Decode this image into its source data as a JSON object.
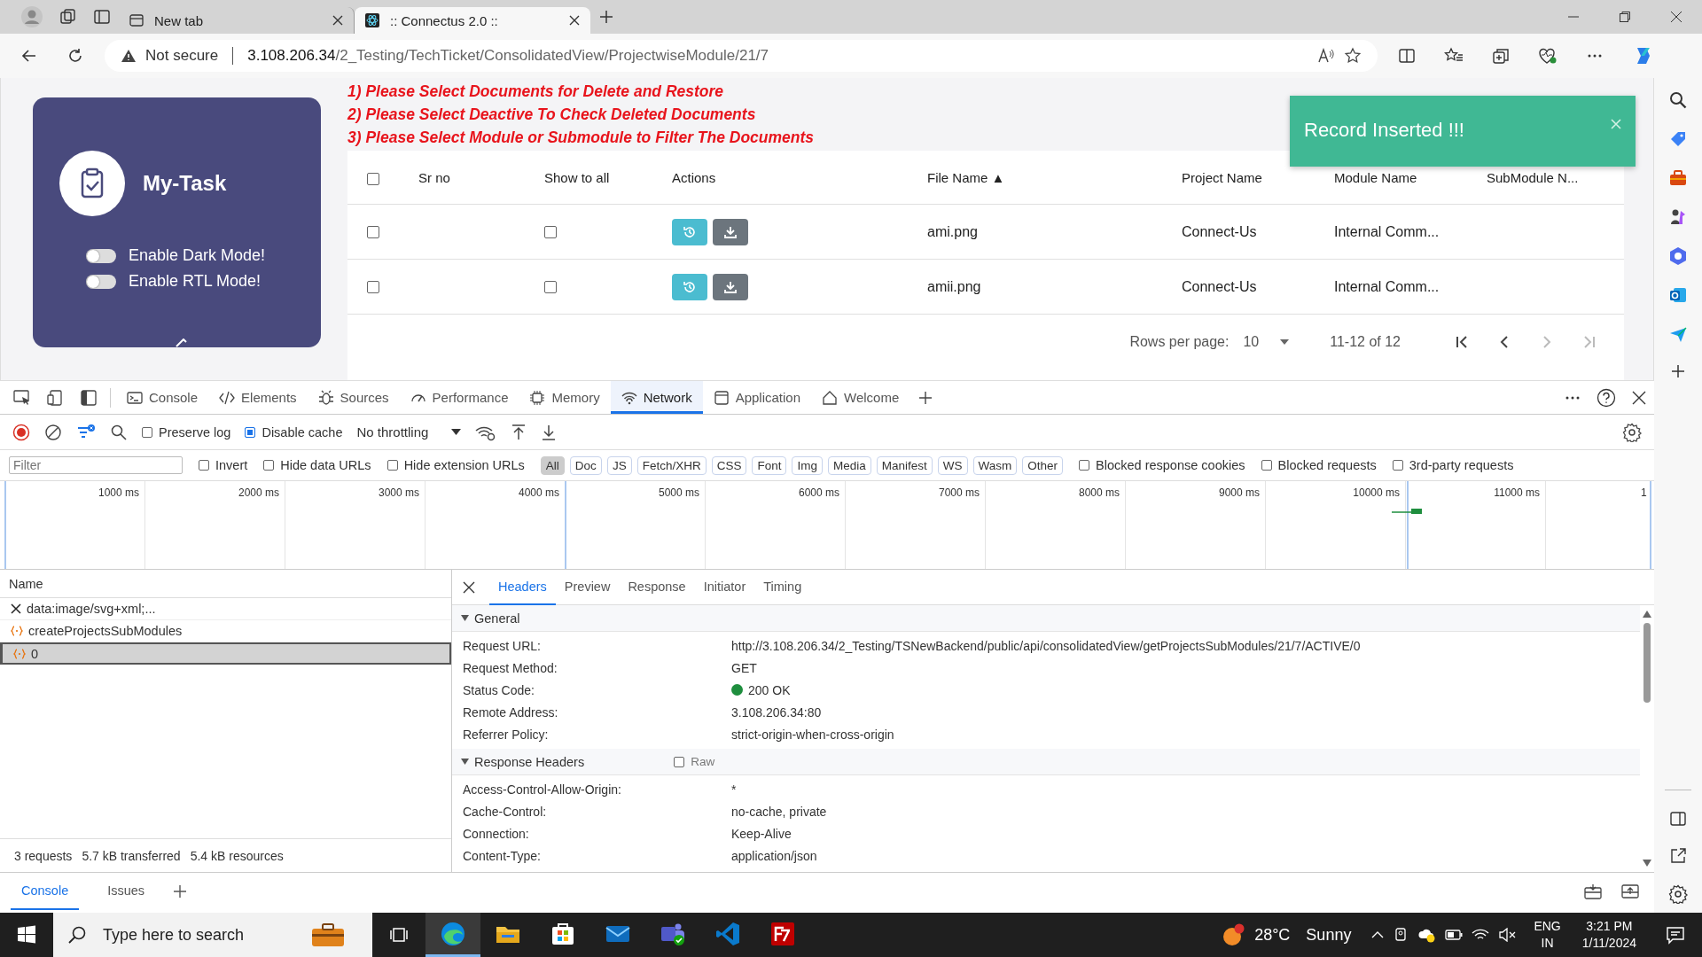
{
  "browser": {
    "tabs": [
      {
        "title": "New tab",
        "selected": false
      },
      {
        "title": ":: Connectus 2.0 ::",
        "selected": true
      }
    ],
    "address": {
      "security": "Not secure",
      "host": "3.108.206.34",
      "path": "/2_Testing/TechTicket/ConsolidatedView/ProjectwiseModule/21/7"
    }
  },
  "page": {
    "card": {
      "title": "My-Task",
      "toggles": [
        {
          "label": "Enable Dark Mode!",
          "on": false
        },
        {
          "label": "Enable RTL Mode!",
          "on": false
        }
      ]
    },
    "instructions": [
      "1) Please Select Documents for Delete and Restore",
      "2) Please Select Deactive To Check Deleted Documents",
      "3) Please Select Module or Submodule to Filter The Documents"
    ],
    "table": {
      "select_all": false,
      "columns": [
        "Sr no",
        "Show to all",
        "Actions",
        "File Name ▲",
        "Project Name",
        "Module Name",
        "SubModule N..."
      ],
      "rows": [
        {
          "checked": false,
          "sr_no": "",
          "show_to_all": false,
          "file_name": "ami.png",
          "project": "Connect-Us",
          "module": "Internal Comm..."
        },
        {
          "checked": false,
          "sr_no": "",
          "show_to_all": false,
          "file_name": "amii.png",
          "project": "Connect-Us",
          "module": "Internal Comm..."
        }
      ]
    },
    "pagination": {
      "label": "Rows per page:",
      "rows_per_page": "10",
      "range": "11-12 of 12"
    },
    "toast": {
      "message": "Record Inserted !!!"
    }
  },
  "devtools": {
    "tabs": [
      {
        "label": "Console",
        "selected": false
      },
      {
        "label": "Elements",
        "selected": false
      },
      {
        "label": "Sources",
        "selected": false
      },
      {
        "label": "Performance",
        "selected": false
      },
      {
        "label": "Memory",
        "selected": false
      },
      {
        "label": "Network",
        "selected": true
      },
      {
        "label": "Application",
        "selected": false
      },
      {
        "label": "Welcome",
        "selected": false
      }
    ],
    "toolbar": {
      "preserve_log": false,
      "preserve_log_label": "Preserve log",
      "disable_cache": true,
      "disable_cache_label": "Disable cache",
      "throttling": "No throttling"
    },
    "filter": {
      "placeholder": "Filter",
      "options": [
        {
          "label": "Invert",
          "checked": false
        },
        {
          "label": "Hide data URLs",
          "checked": false
        },
        {
          "label": "Hide extension URLs",
          "checked": false
        }
      ],
      "types": [
        {
          "label": "All",
          "selected": true
        },
        {
          "label": "Doc",
          "selected": false
        },
        {
          "label": "JS",
          "selected": false
        },
        {
          "label": "Fetch/XHR",
          "selected": false
        },
        {
          "label": "CSS",
          "selected": false
        },
        {
          "label": "Font",
          "selected": false
        },
        {
          "label": "Img",
          "selected": false
        },
        {
          "label": "Media",
          "selected": false
        },
        {
          "label": "Manifest",
          "selected": false
        },
        {
          "label": "WS",
          "selected": false
        },
        {
          "label": "Wasm",
          "selected": false
        },
        {
          "label": "Other",
          "selected": false
        }
      ],
      "extra_options": [
        {
          "label": "Blocked response cookies",
          "checked": false
        },
        {
          "label": "Blocked requests",
          "checked": false
        },
        {
          "label": "3rd-party requests",
          "checked": false
        }
      ]
    },
    "timeline": {
      "ticks": [
        "1000 ms",
        "2000 ms",
        "3000 ms",
        "4000 ms",
        "5000 ms",
        "6000 ms",
        "7000 ms",
        "8000 ms",
        "9000 ms",
        "10000 ms",
        "11000 ms",
        "1"
      ]
    },
    "requests": {
      "header": "Name",
      "items": [
        {
          "name": "data:image/svg+xml;...",
          "kind": "failed",
          "selected": false
        },
        {
          "name": "createProjectsSubModules",
          "kind": "fetch",
          "selected": false
        },
        {
          "name": "0",
          "kind": "fetch",
          "selected": true
        }
      ],
      "summary": [
        "3 requests",
        "5.7 kB transferred",
        "5.4 kB resources"
      ]
    },
    "details": {
      "tabs": [
        {
          "label": "Headers",
          "selected": true
        },
        {
          "label": "Preview",
          "selected": false
        },
        {
          "label": "Response",
          "selected": false
        },
        {
          "label": "Initiator",
          "selected": false
        },
        {
          "label": "Timing",
          "selected": false
        }
      ],
      "sections": [
        {
          "title": "General",
          "expanded": true,
          "rows": [
            {
              "key": "Request URL:",
              "value": "http://3.108.206.34/2_Testing/TSNewBackend/public/api/consolidatedView/getProjectsSubModules/21/7/ACTIVE/0",
              "kind": "text"
            },
            {
              "key": "Request Method:",
              "value": "GET",
              "kind": "text"
            },
            {
              "key": "Status Code:",
              "value": "200 OK",
              "kind": "status"
            },
            {
              "key": "Remote Address:",
              "value": "3.108.206.34:80",
              "kind": "text"
            },
            {
              "key": "Referrer Policy:",
              "value": "strict-origin-when-cross-origin",
              "kind": "text"
            }
          ]
        },
        {
          "title": "Response Headers",
          "expanded": true,
          "raw_label": "Raw",
          "raw": false,
          "rows": [
            {
              "key": "Access-Control-Allow-Origin:",
              "value": "*",
              "kind": "text"
            },
            {
              "key": "Cache-Control:",
              "value": "no-cache, private",
              "kind": "text"
            },
            {
              "key": "Connection:",
              "value": "Keep-Alive",
              "kind": "text"
            },
            {
              "key": "Content-Type:",
              "value": "application/json",
              "kind": "text"
            }
          ]
        }
      ]
    },
    "drawer": {
      "tabs": [
        {
          "label": "Console",
          "selected": true
        },
        {
          "label": "Issues",
          "selected": false
        }
      ]
    }
  },
  "taskbar": {
    "search_placeholder": "Type here to search",
    "weather": {
      "temperature": "28°C",
      "condition": "Sunny"
    },
    "language": [
      "ENG",
      "IN"
    ],
    "time": "3:21 PM",
    "date": "1/11/2024"
  }
}
